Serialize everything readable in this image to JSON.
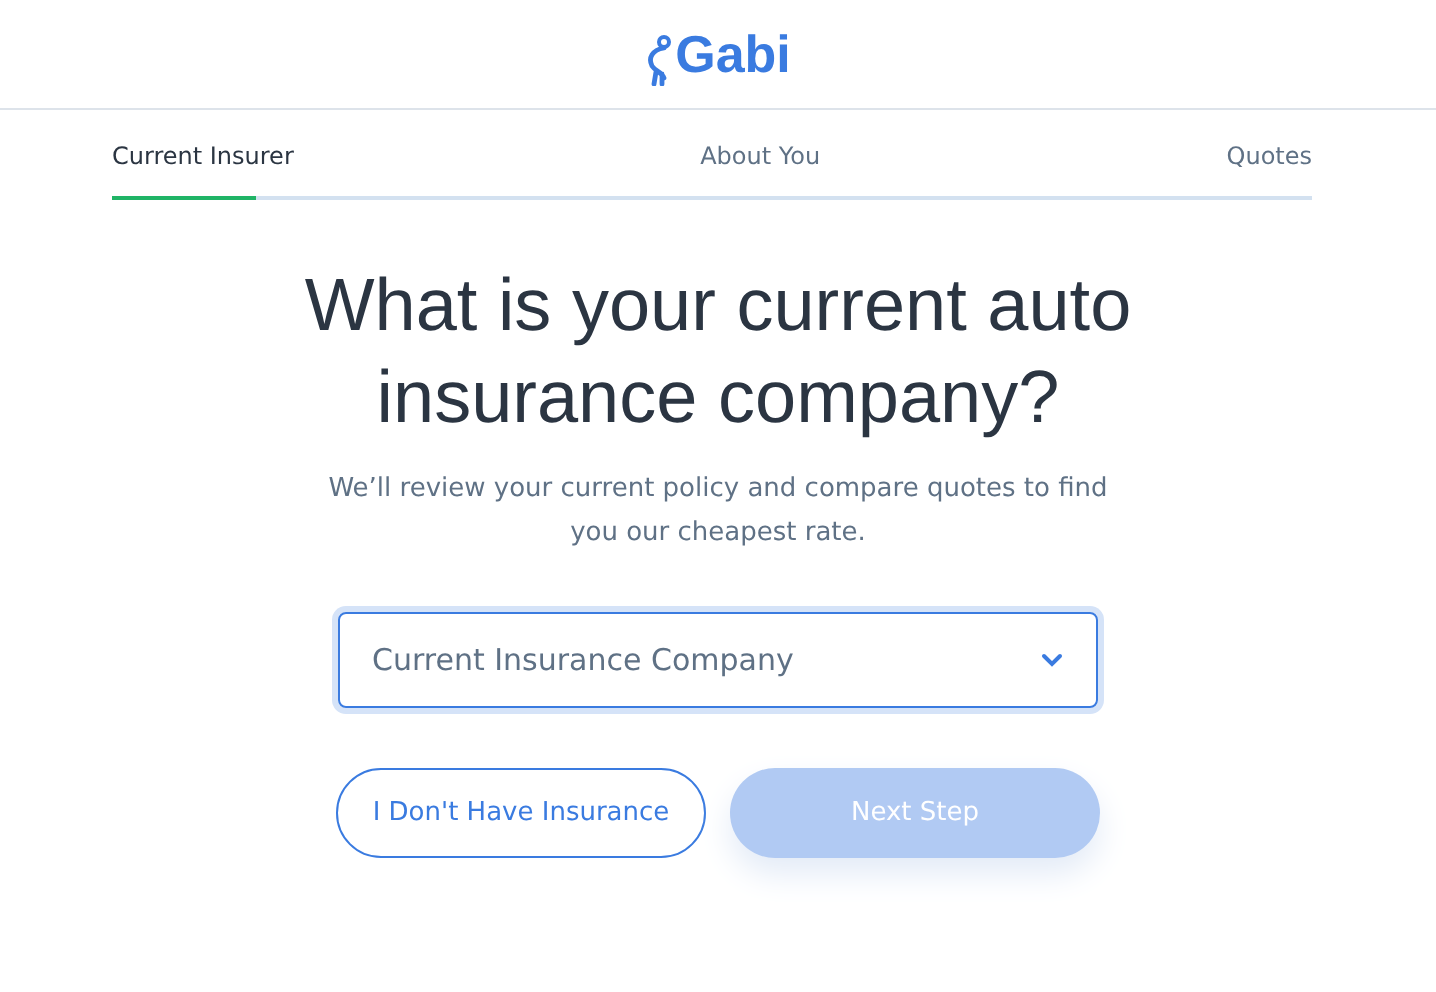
{
  "header": {
    "logo": "Gabi"
  },
  "steps": [
    {
      "label": "Current Insurer",
      "selected": true
    },
    {
      "label": "About You",
      "selected": false
    },
    {
      "label": "Quotes",
      "selected": false
    }
  ],
  "progress": {
    "level": 0.12
  },
  "heading": "What is your current auto insurance company?",
  "subtitle": "We’ll review your current policy and compare quotes to find you our cheapest rate.",
  "select": {
    "placeholder": "Current Insurance Company"
  },
  "buttons": [
    {
      "label": "I Don't Have Insurance",
      "kind": "outline",
      "disabled": false
    },
    {
      "label": "Next Step",
      "kind": "primary",
      "disabled": true
    }
  ]
}
